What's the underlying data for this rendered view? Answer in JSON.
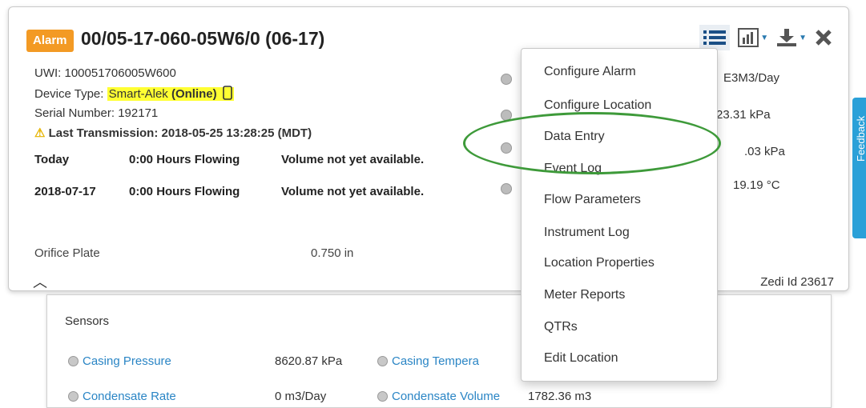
{
  "header": {
    "badge": "Alarm",
    "title": "00/05-17-060-05W6/0 (06-17)"
  },
  "toolbar": {
    "icons": [
      "list-icon",
      "chart-icon",
      "download-icon",
      "close-icon"
    ]
  },
  "info": {
    "uwi": "UWI: 100051706005W600",
    "device_label": "Device Type: ",
    "device_name": "Smart-Alek ",
    "device_status": "(Online)",
    "serial": "Serial Number: 192171",
    "last_transmission": "Last Transmission: 2018-05-25 13:28:25 (MDT)"
  },
  "flow_rows": [
    {
      "date": "Today",
      "hours": "0:00 Hours Flowing",
      "volume": "Volume not yet available."
    },
    {
      "date": "2018-07-17",
      "hours": "0:00 Hours Flowing",
      "volume": "Volume not yet available."
    }
  ],
  "orifice": {
    "label": "Orifice Plate",
    "value": "0.750 in"
  },
  "right_values": [
    "E3M3/Day",
    "-23.31 kPa",
    ".03 kPa",
    "19.19 °C"
  ],
  "zedi_id": "Zedi Id 23617",
  "menu": {
    "items": [
      "Configure Alarm",
      "Configure Location",
      "Data Entry",
      "Event Log",
      "Flow Parameters",
      "Instrument Log",
      "Location Properties",
      "Meter Reports",
      "QTRs",
      "Edit Location"
    ]
  },
  "sensors": {
    "title": "Sensors",
    "rows": [
      {
        "name1": "Casing Pressure",
        "value1": "8620.87 kPa",
        "name2": "Casing Tempera"
      },
      {
        "name1": "Condensate Rate",
        "value1": "0 m3/Day",
        "name2": "Condensate Volume",
        "value2": "1782.36 m3"
      }
    ]
  },
  "feedback": {
    "label": "Feedback"
  },
  "colors": {
    "badge": "#f39a24",
    "link": "#2a85c5",
    "highlight": "#ffff33",
    "oval": "#3e9a3a",
    "feedback_tab": "#2aa0d8"
  }
}
